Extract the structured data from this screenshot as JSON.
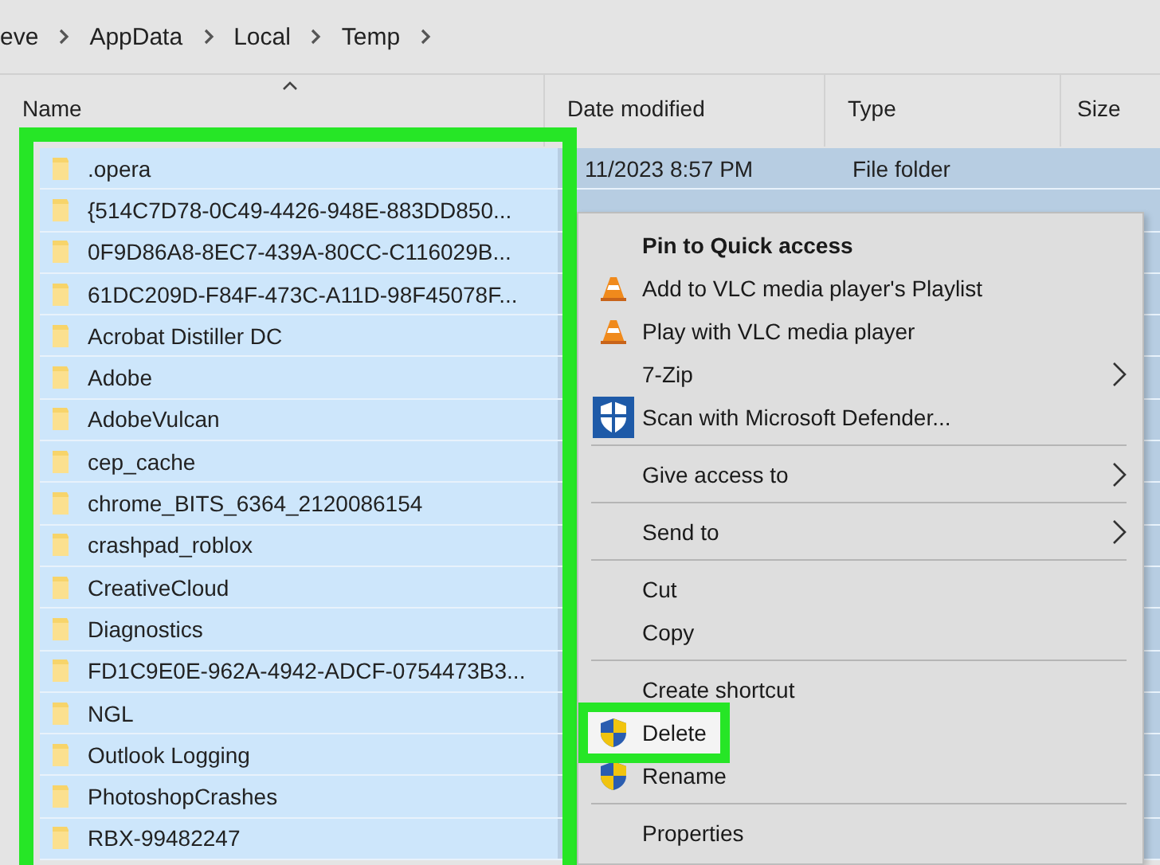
{
  "breadcrumb": [
    "eve",
    "AppData",
    "Local",
    "Temp"
  ],
  "columns": [
    "Name",
    "Date modified",
    "Type",
    "Size"
  ],
  "rows": [
    {
      "name": ".opera",
      "date": "11/2023 8:57 PM",
      "type": "File folder",
      "selected": true
    },
    {
      "name": "{514C7D78-0C49-4426-948E-883DD850...",
      "selected": true
    },
    {
      "name": "0F9D86A8-8EC7-439A-80CC-C116029B...",
      "selected": true
    },
    {
      "name": "61DC209D-F84F-473C-A11D-98F45078F...",
      "selected": true
    },
    {
      "name": "Acrobat Distiller DC",
      "selected": true
    },
    {
      "name": "Adobe",
      "selected": true
    },
    {
      "name": "AdobeVulcan",
      "selected": true
    },
    {
      "name": "cep_cache",
      "selected": true
    },
    {
      "name": "chrome_BITS_6364_2120086154",
      "selected": true
    },
    {
      "name": "crashpad_roblox",
      "selected": true
    },
    {
      "name": "CreativeCloud",
      "selected": true
    },
    {
      "name": "Diagnostics",
      "selected": true
    },
    {
      "name": "FD1C9E0E-962A-4942-ADCF-0754473B3...",
      "selected": true
    },
    {
      "name": "NGL",
      "selected": true
    },
    {
      "name": "Outlook Logging",
      "selected": true
    },
    {
      "name": "PhotoshopCrashes",
      "selected": true
    },
    {
      "name": "RBX-99482247",
      "selected": true
    }
  ],
  "context_menu": [
    {
      "kind": "item",
      "label": "Pin to Quick access",
      "bold": true
    },
    {
      "kind": "cone_item",
      "label": "Add to VLC media player's Playlist"
    },
    {
      "kind": "cone_item",
      "label": "Play with VLC media player"
    },
    {
      "kind": "item",
      "label": "7-Zip",
      "submenu": true
    },
    {
      "kind": "defender_item",
      "label": "Scan with Microsoft Defender..."
    },
    {
      "kind": "separator"
    },
    {
      "kind": "item",
      "label": "Give access to",
      "submenu": true
    },
    {
      "kind": "separator"
    },
    {
      "kind": "item",
      "label": "Send to",
      "submenu": true
    },
    {
      "kind": "separator"
    },
    {
      "kind": "item",
      "label": "Cut"
    },
    {
      "kind": "item",
      "label": "Copy"
    },
    {
      "kind": "separator"
    },
    {
      "kind": "item",
      "label": "Create shortcut"
    },
    {
      "kind": "shield_item",
      "label": "Delete",
      "highlighted": true
    },
    {
      "kind": "shield_item",
      "label": "Rename"
    },
    {
      "kind": "separator"
    },
    {
      "kind": "item",
      "label": "Properties"
    }
  ]
}
